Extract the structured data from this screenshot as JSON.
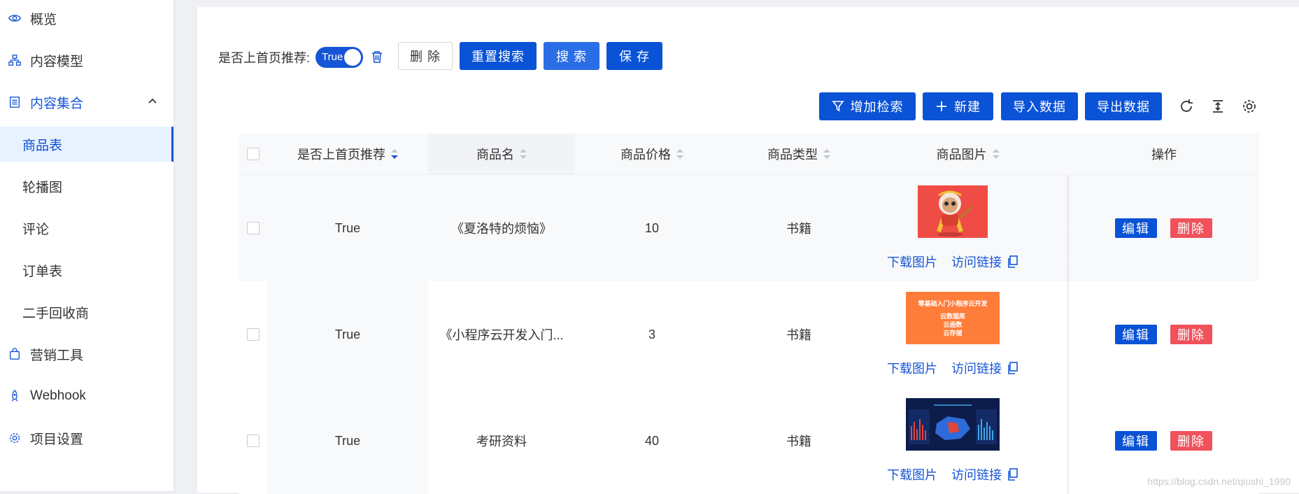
{
  "sidebar": {
    "items": [
      {
        "label": "概览",
        "icon": "eye-icon"
      },
      {
        "label": "内容模型",
        "icon": "sitemap-icon"
      },
      {
        "label": "内容集合",
        "icon": "list-icon",
        "expanded": true
      },
      {
        "label": "商品表",
        "active": true
      },
      {
        "label": "轮播图"
      },
      {
        "label": "评论"
      },
      {
        "label": "订单表"
      },
      {
        "label": "二手回收商"
      },
      {
        "label": "营销工具",
        "icon": "shopping-bag-icon"
      },
      {
        "label": "Webhook",
        "icon": "rocket-icon"
      },
      {
        "label": "项目设置",
        "icon": "gear-icon"
      }
    ]
  },
  "filter": {
    "label": "是否上首页推荐:",
    "switch_value": "True",
    "buttons": {
      "delete": "删 除",
      "reset": "重置搜索",
      "search": "搜 索",
      "save": "保 存"
    }
  },
  "toolbar": {
    "add_filter": "增加检索",
    "create": "新建",
    "import": "导入数据",
    "export": "导出数据"
  },
  "table": {
    "columns": [
      "是否上首页推荐",
      "商品名",
      "商品价格",
      "商品类型",
      "商品图片",
      "操作"
    ],
    "rows": [
      {
        "recommend": "True",
        "name": "《夏洛特的烦恼》",
        "price": "10",
        "type": "书籍"
      },
      {
        "recommend": "True",
        "name": "《小程序云开发入门...",
        "price": "3",
        "type": "书籍"
      },
      {
        "recommend": "True",
        "name": "考研资料",
        "price": "40",
        "type": "书籍"
      }
    ],
    "image_links": {
      "download": "下载图片",
      "visit": "访问链接"
    },
    "actions": {
      "edit": "编辑",
      "delete": "删除"
    },
    "thumb2_text": [
      "零基础入门小程序云开发",
      "云数据库",
      "云函数",
      "云存储"
    ]
  },
  "colors": {
    "primary": "#0a52d6",
    "danger": "#f0515a",
    "active_bg": "#e8f2ff"
  },
  "watermark": "https://blog.csdn.net/qiushi_1990"
}
